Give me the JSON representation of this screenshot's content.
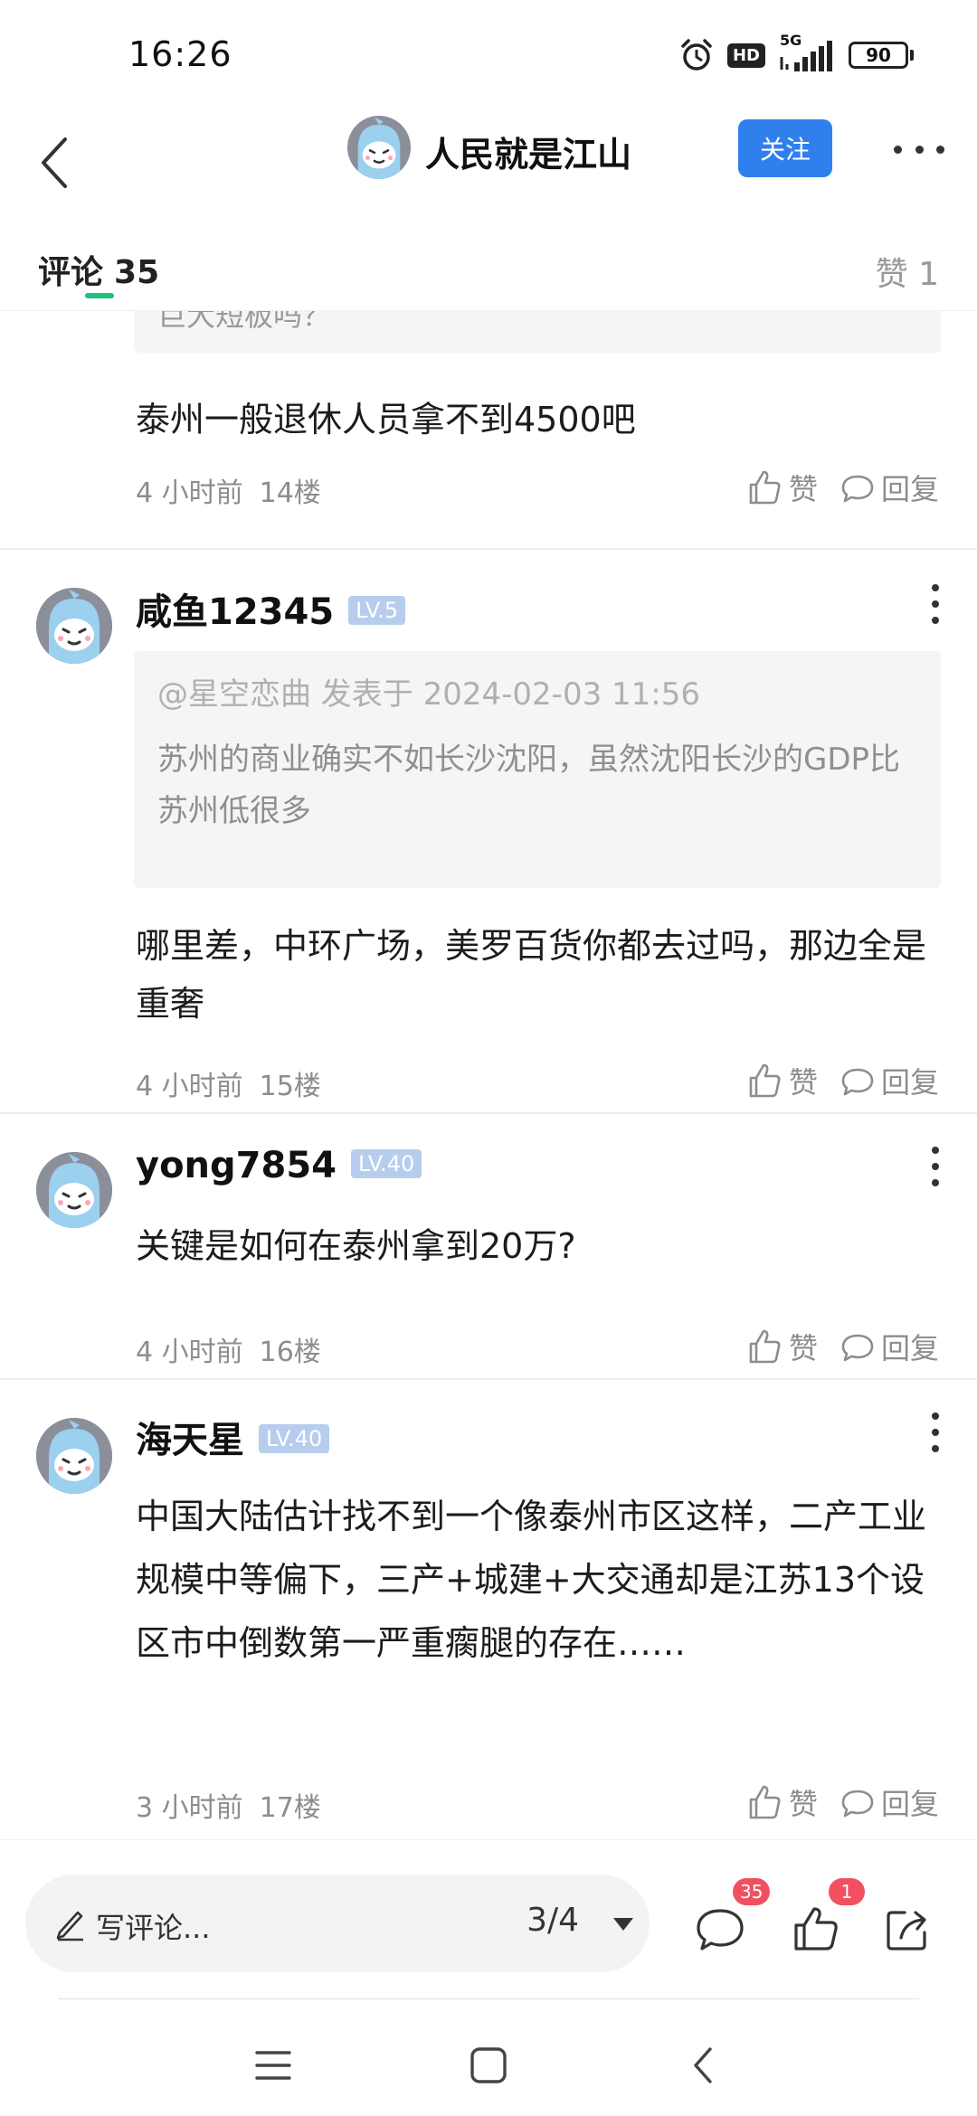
{
  "status_bar": {
    "time": "16:26",
    "hd": "HD",
    "network": "5G",
    "battery": "90"
  },
  "header": {
    "title": "人民就是江山",
    "follow_label": "关注",
    "back_icon": "chevron-left-icon",
    "more_icon": "more-dots-icon"
  },
  "tabs": {
    "comments_label": "评论",
    "comments_count": "35",
    "likes_label": "赞 1",
    "accent_color": "#19c37d"
  },
  "feed": {
    "top_quote_fragment": "巨大短板吗？",
    "comments": [
      {
        "text": "泰州一般退休人员拿不到4500吧",
        "time": "4 小时前",
        "floor": "14楼"
      },
      {
        "user": "咸鱼12345",
        "level": "LV.5",
        "quote_head": "@星空恋曲 发表于 2024-02-03 11:56",
        "quote_body": "苏州的商业确实不如长沙沈阳，虽然沈阳长沙的GDP比苏州低很多",
        "text": "哪里差，中环广场，美罗百货你都去过吗，那边全是重奢",
        "time": "4 小时前",
        "floor": "15楼"
      },
      {
        "user": "yong7854",
        "level": "LV.40",
        "text": "关键是如何在泰州拿到20万?",
        "time": "4 小时前",
        "floor": "16楼"
      },
      {
        "user": "海天星",
        "level": "LV.40",
        "text": "中国大陆估计找不到一个像泰州市区这样，二产工业规模中等偏下，三产+城建+大交通却是江苏13个设区市中倒数第一严重瘸腿的存在……",
        "time": "3 小时前",
        "floor": "17楼"
      }
    ],
    "like_label": "赞",
    "reply_label": "回复"
  },
  "bottom_bar": {
    "write_placeholder": "写评论...",
    "page_indicator": "3/4",
    "comment_badge": "35",
    "like_badge": "1",
    "badge_color": "#f05060"
  },
  "colors": {
    "follow_button": "#2f80ed",
    "level_badge": "#b6cdee"
  }
}
